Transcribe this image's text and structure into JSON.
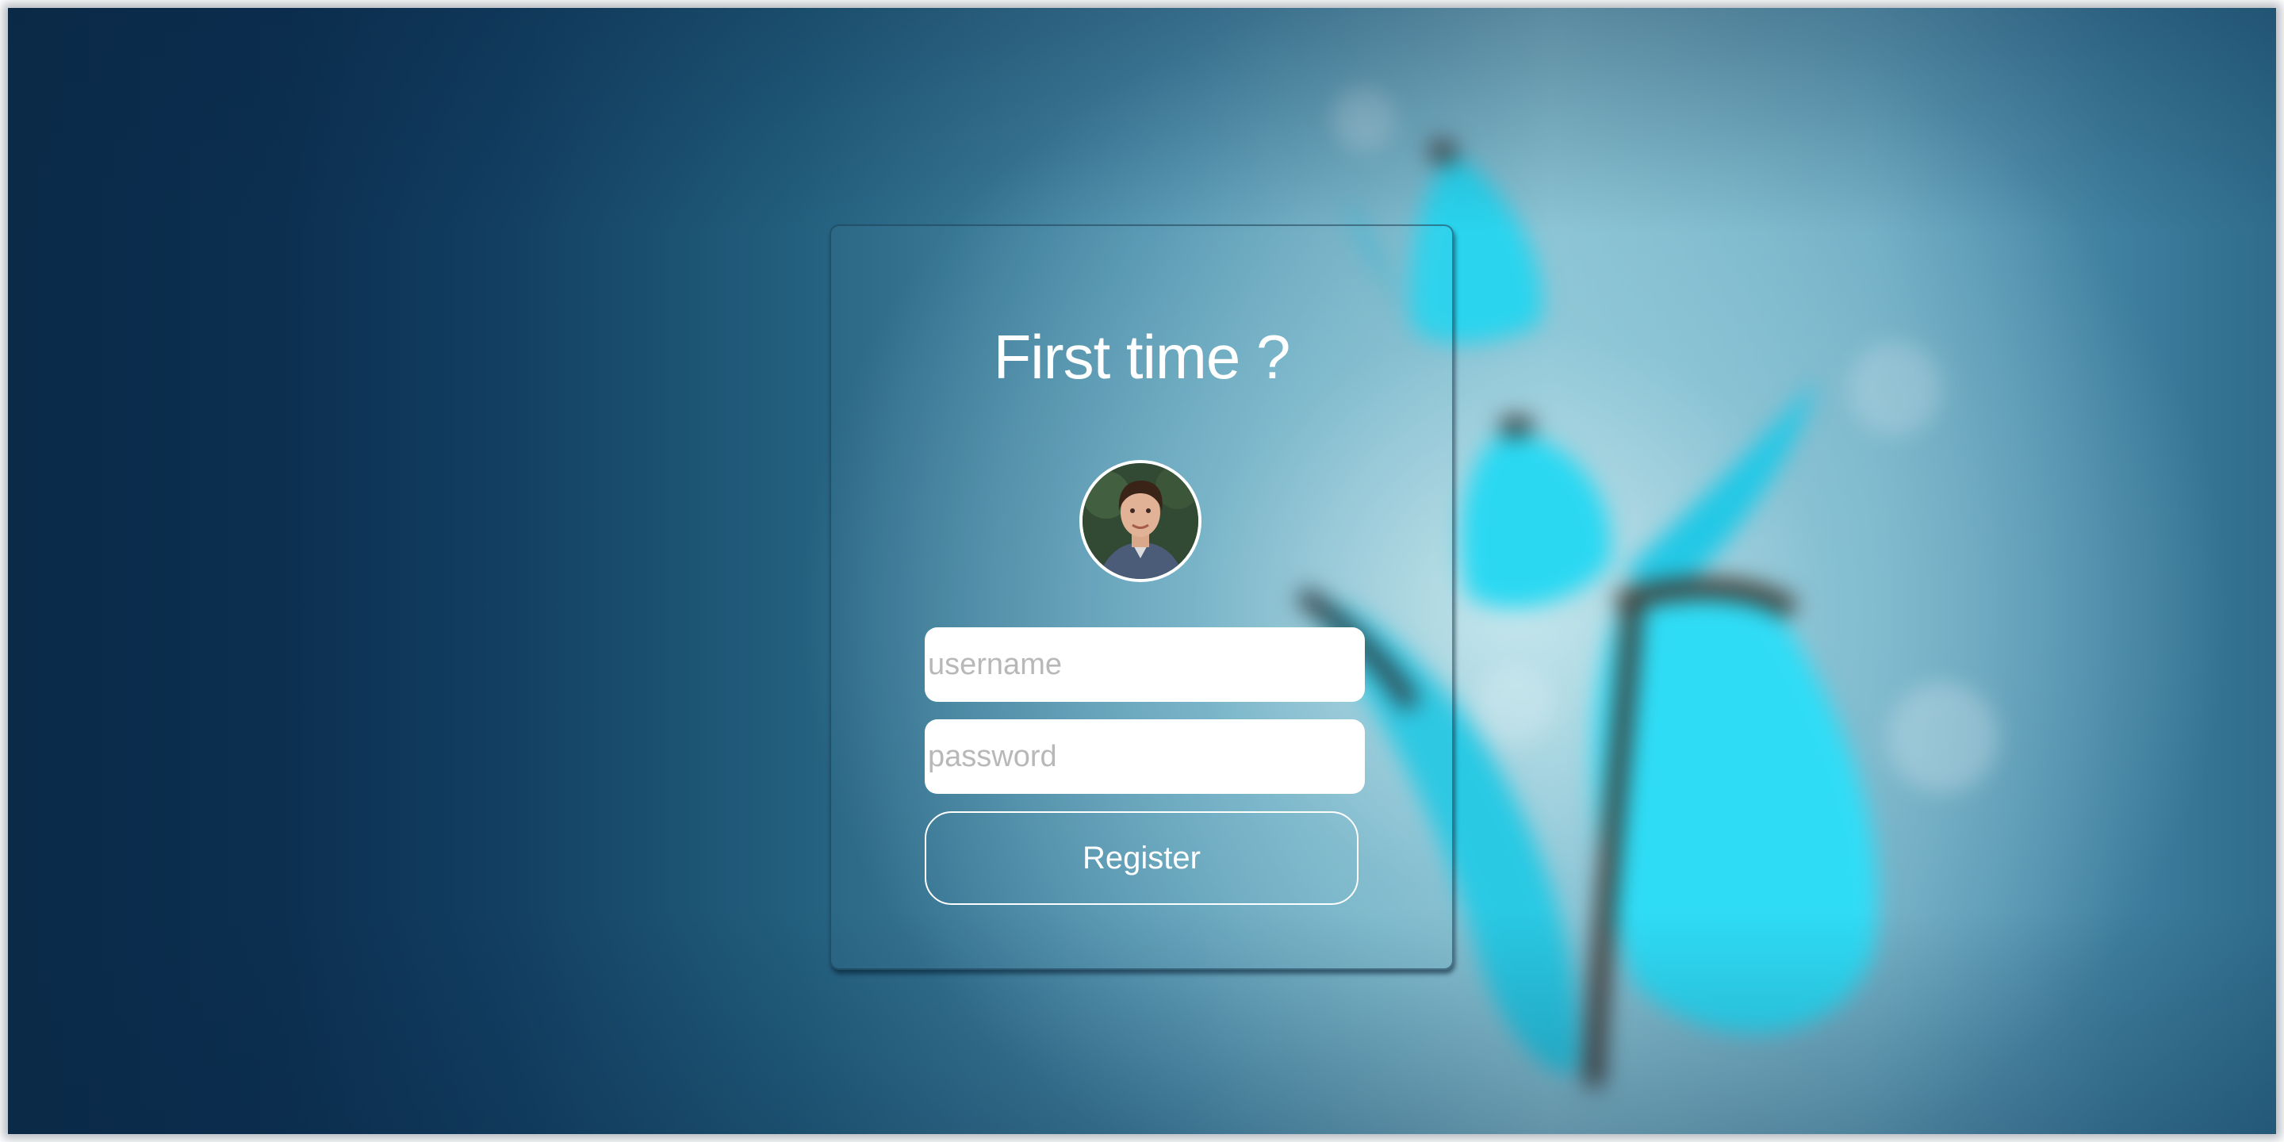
{
  "card": {
    "title": "First time ?"
  },
  "form": {
    "username_placeholder": "username",
    "password_placeholder": "password",
    "register_label": "Register"
  },
  "avatar": {
    "icon": "user-photo"
  },
  "colors": {
    "background_dark": "#0a2a48",
    "background_light": "#c8e8ee",
    "butterfly": "#2fd8f0",
    "text": "#ffffff"
  }
}
